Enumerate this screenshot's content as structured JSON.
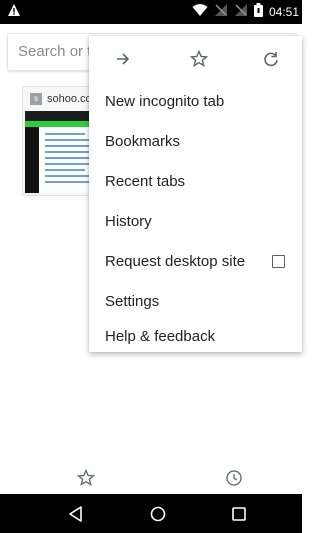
{
  "status_bar": {
    "time": "04:51",
    "icons": [
      "warning-icon",
      "wifi-icon",
      "no-signal-icon",
      "no-signal-icon",
      "battery-icon"
    ]
  },
  "omnibox": {
    "placeholder": "Search or type URL"
  },
  "suggestion_tile": {
    "favicon_letter": "s",
    "title": "sohoo.cc"
  },
  "menu": {
    "top_icons": [
      "forward-icon",
      "bookmark-star-icon",
      "refresh-icon"
    ],
    "items": [
      {
        "label": "New incognito tab"
      },
      {
        "label": "Bookmarks"
      },
      {
        "label": "Recent tabs"
      },
      {
        "label": "History"
      },
      {
        "label": "Request desktop site",
        "checkbox": false
      },
      {
        "label": "Settings"
      },
      {
        "label": "Help & feedback"
      }
    ]
  },
  "bottom_toolbar": {
    "icons": [
      "bookmarks-star-icon",
      "history-clock-icon"
    ]
  },
  "nav_bar": {
    "icons": [
      "back-triangle-icon",
      "home-circle-icon",
      "recents-square-icon"
    ]
  },
  "colors": {
    "status_bar": "#000000",
    "menu_text": "#222222",
    "icon_gray": "#5f6368",
    "placeholder": "#8a8a8a"
  }
}
